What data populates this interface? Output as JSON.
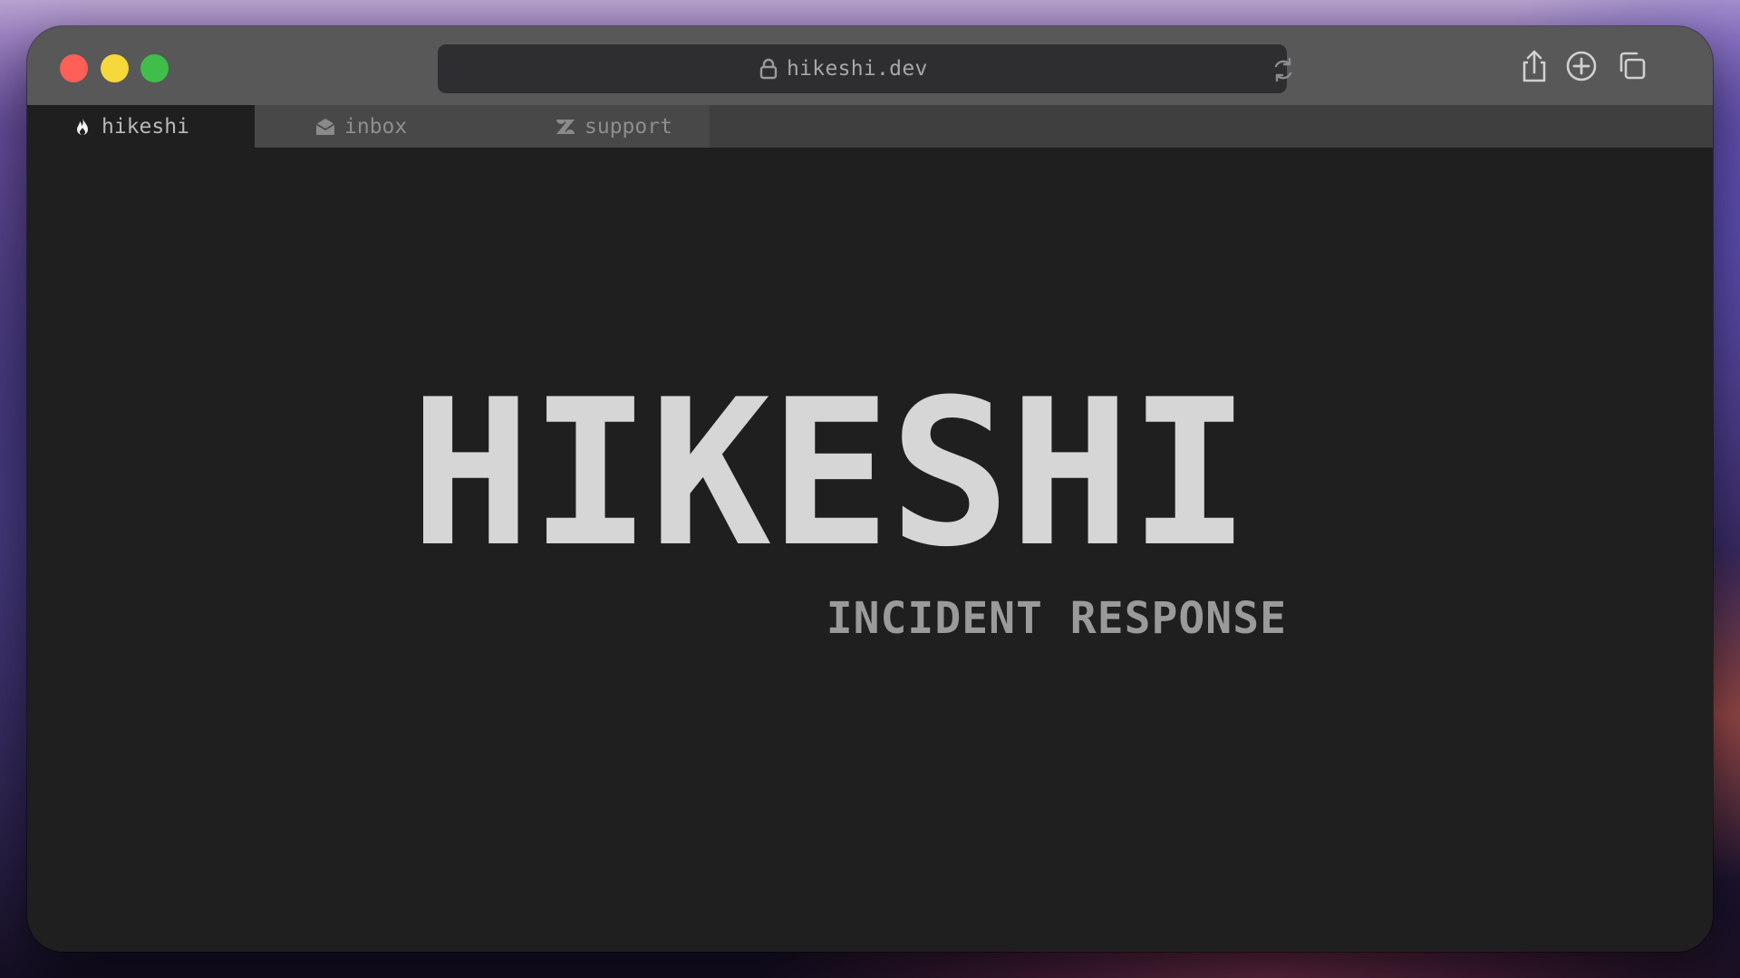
{
  "browser": {
    "url": "hikeshi.dev",
    "icons": {
      "lock": "lock-icon",
      "reload": "reload-icon",
      "share": "share-icon",
      "new_tab": "plus-circle-icon",
      "tabs": "tabs-overview-icon"
    },
    "traffic_light_colors": [
      "#fe5f57",
      "#f7d83a",
      "#3fbe4a"
    ]
  },
  "tabs": [
    {
      "label": "hikeshi",
      "icon": "flame-icon",
      "active": true
    },
    {
      "label": "inbox",
      "icon": "envelope-icon",
      "active": false
    },
    {
      "label": "support",
      "icon": "zendesk-icon",
      "active": false
    }
  ],
  "page": {
    "title": "HIKESHI",
    "subtitle": "INCIDENT RESPONSE",
    "background_color": "#1f1f1f",
    "title_color": "#d6d6d6",
    "subtitle_color": "#9a9a9a"
  }
}
